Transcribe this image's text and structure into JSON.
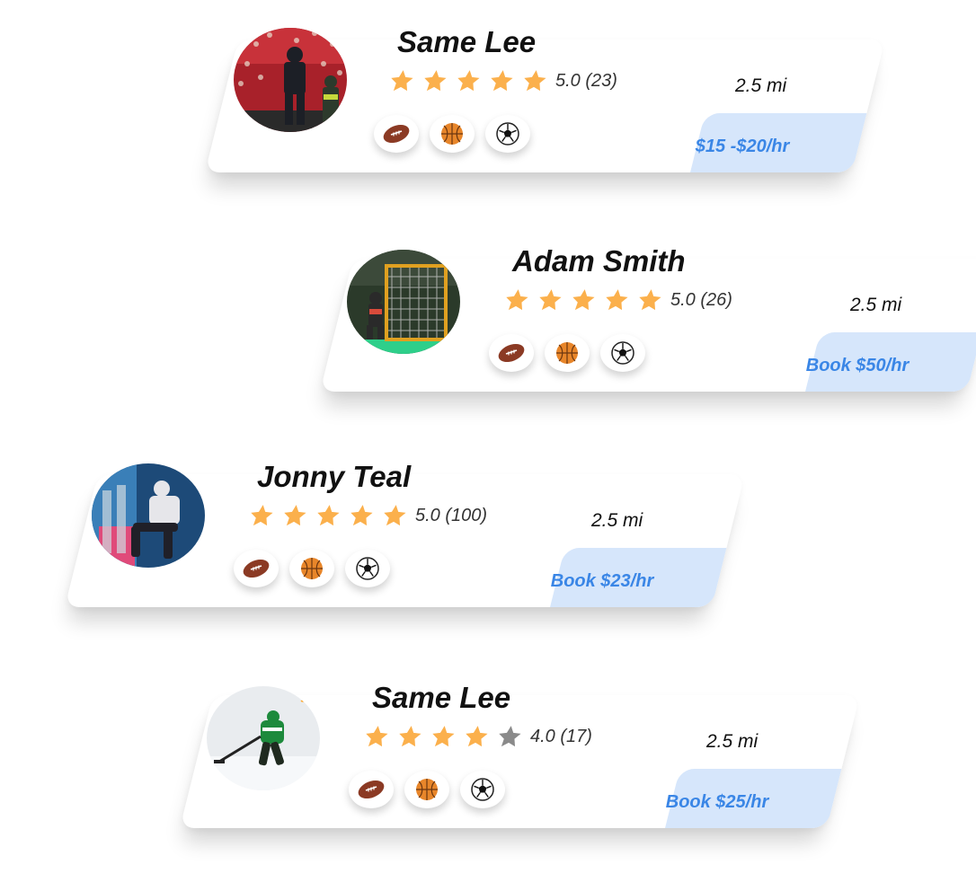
{
  "cards": [
    {
      "name": "Same Lee",
      "rating_text": "5.0 (23)",
      "stars_filled": 5,
      "distance": "2.5 mi",
      "book_label": "$15 -$20/hr",
      "sports": [
        "football-icon",
        "basketball-icon",
        "soccer-icon"
      ]
    },
    {
      "name": "Adam Smith",
      "rating_text": "5.0 (26)",
      "stars_filled": 5,
      "distance": "2.5 mi",
      "book_label": "Book $50/hr",
      "sports": [
        "football-icon",
        "basketball-icon",
        "soccer-icon"
      ]
    },
    {
      "name": "Jonny Teal",
      "rating_text": "5.0 (100)",
      "stars_filled": 5,
      "distance": "2.5 mi",
      "book_label": "Book $23/hr",
      "sports": [
        "football-icon",
        "basketball-icon",
        "soccer-icon"
      ]
    },
    {
      "name": "Same Lee",
      "rating_text": "4.0 (17)",
      "stars_filled": 4,
      "distance": "2.5 mi",
      "book_label": "Book $25/hr",
      "sports": [
        "football-icon",
        "basketball-icon",
        "soccer-icon"
      ]
    }
  ],
  "colors": {
    "star_filled": "#fbb04c",
    "star_empty": "#8a8a8a",
    "book_bg": "#d6e6fb",
    "book_text": "#3a86e6",
    "football": "#8b3a24",
    "basketball": "#e8862a"
  }
}
